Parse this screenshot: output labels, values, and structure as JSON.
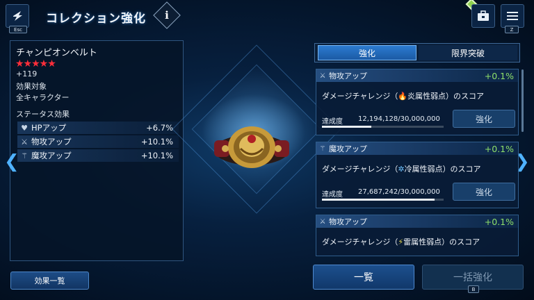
{
  "header": {
    "title": "コレクション強化",
    "esc_key": "Esc",
    "menu_key": "Z"
  },
  "item": {
    "name": "チャンピオンベルト",
    "stars": "★★★★★",
    "level": "+119",
    "effect_target_label": "効果対象",
    "effect_target_value": "全キャラクター",
    "status_heading": "ステータス効果",
    "stats": [
      {
        "icon": "heart-icon",
        "glyph": "♥",
        "name": "HPアップ",
        "value": "+6.7%"
      },
      {
        "icon": "sword-icon",
        "glyph": "⚔",
        "name": "物攻アップ",
        "value": "+10.1%"
      },
      {
        "icon": "staff-icon",
        "glyph": "⚚",
        "name": "魔攻アップ",
        "value": "+10.1%"
      }
    ]
  },
  "buttons": {
    "effect_list": "効果一覧",
    "list": "一覧",
    "bulk_enhance": "一括強化",
    "bulk_key": "B"
  },
  "tabs": [
    {
      "label": "強化",
      "active": true
    },
    {
      "label": "限界突破",
      "active": false
    }
  ],
  "cards": [
    {
      "icon": "sword-icon",
      "glyph": "⚔",
      "name": "物攻アップ",
      "bonus": "+0.1%",
      "desc_prefix": "ダメージチャレンジ（",
      "element_glyph": "🔥",
      "element_class": "flame",
      "desc_element": "炎属性弱点",
      "desc_suffix": "）のスコア",
      "progress_label": "達成度",
      "progress_value": "12,194,128/30,000,000",
      "progress": 0.406,
      "button": "強化"
    },
    {
      "icon": "staff-icon",
      "glyph": "⚚",
      "name": "魔攻アップ",
      "bonus": "+0.1%",
      "desc_prefix": "ダメージチャレンジ（",
      "element_glyph": "✲",
      "element_class": "snow",
      "desc_element": "冷属性弱点",
      "desc_suffix": "）のスコア",
      "progress_label": "達成度",
      "progress_value": "27,687,242/30,000,000",
      "progress": 0.923,
      "button": "強化"
    },
    {
      "icon": "sword-icon",
      "glyph": "⚔",
      "name": "物攻アップ",
      "bonus": "+0.1%",
      "desc_prefix": "ダメージチャレンジ（",
      "element_glyph": "⚡",
      "element_class": "bolt",
      "desc_element": "雷属性弱点",
      "desc_suffix": "）のスコア"
    }
  ],
  "colors": {
    "accent": "#2c7bd0",
    "bonus_green": "#8fe06a",
    "star_red": "#ff2e3a"
  }
}
